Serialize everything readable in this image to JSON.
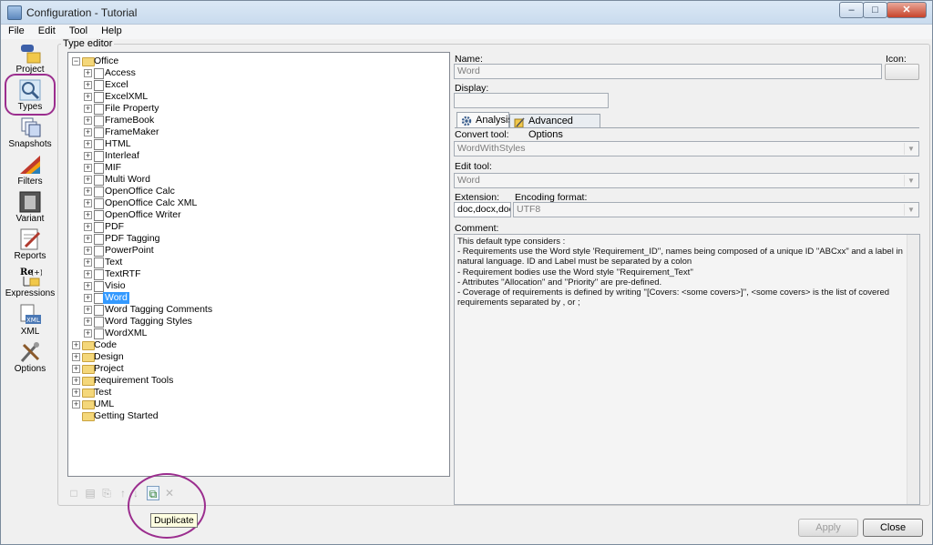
{
  "window": {
    "title": "Configuration - Tutorial",
    "minimize": "–",
    "maximize": "□",
    "close": "✕"
  },
  "menu": [
    "File",
    "Edit",
    "Tool",
    "Help"
  ],
  "sidebar": [
    {
      "label": "Project",
      "icon": "project-icon"
    },
    {
      "label": "Types",
      "icon": "types-icon"
    },
    {
      "label": "Snapshots",
      "icon": "snapshots-icon"
    },
    {
      "label": "Filters",
      "icon": "filters-icon"
    },
    {
      "label": "Variant",
      "icon": "variant-icon"
    },
    {
      "label": "Reports",
      "icon": "reports-icon"
    },
    {
      "label": "Expressions",
      "icon": "expressions-icon"
    },
    {
      "label": "XML",
      "icon": "xml-icon"
    },
    {
      "label": "Options",
      "icon": "options-icon"
    }
  ],
  "type_editor": {
    "caption": "Type editor",
    "tree": {
      "office": "Office",
      "office_items": [
        "Access",
        "Excel",
        "ExcelXML",
        "File Property",
        "FrameBook",
        "FrameMaker",
        "HTML",
        "Interleaf",
        "MIF",
        "Multi Word",
        "OpenOffice Calc",
        "OpenOffice Calc XML",
        "OpenOffice Writer",
        "PDF",
        "PDF Tagging",
        "PowerPoint",
        "Text",
        "TextRTF",
        "Visio",
        "Word",
        "Word Tagging Comments",
        "Word Tagging Styles",
        "WordXML"
      ],
      "selected": "Word",
      "other_folders": [
        "Code",
        "Design",
        "Project",
        "Requirement Tools",
        "Test",
        "UML",
        "Getting Started"
      ]
    },
    "tooltip": "Duplicate"
  },
  "properties": {
    "name_label": "Name:",
    "name_value": "Word",
    "icon_label": "Icon:",
    "display_label": "Display:",
    "display_value": "",
    "tabs": [
      "Analysis",
      "Advanced Options"
    ],
    "convert_tool_label": "Convert tool:",
    "convert_tool_value": "WordWithStyles",
    "edit_tool_label": "Edit tool:",
    "edit_tool_value": "Word",
    "extension_label": "Extension:",
    "extension_value": "doc,docx,docm",
    "encoding_label": "Encoding format:",
    "encoding_value": "UTF8",
    "comment_label": "Comment:",
    "comment_lines": [
      "This default type considers :",
      "- Requirements use the Word style 'Requirement_ID'', names being composed of a unique ID \"ABCxx\" and a label in natural language. ID and Label must be separated by a colon",
      "- Requirement bodies use the Word style ''Requirement_Text''",
      "- Attributes ''Allocation'' and ''Priority'' are pre-defined.",
      "- Coverage of requirements is defined by writing ''[Covers: <some covers>]'', <some covers> is the list of covered requirements separated by , or ;"
    ]
  },
  "buttons": {
    "apply": "Apply",
    "close": "Close"
  }
}
